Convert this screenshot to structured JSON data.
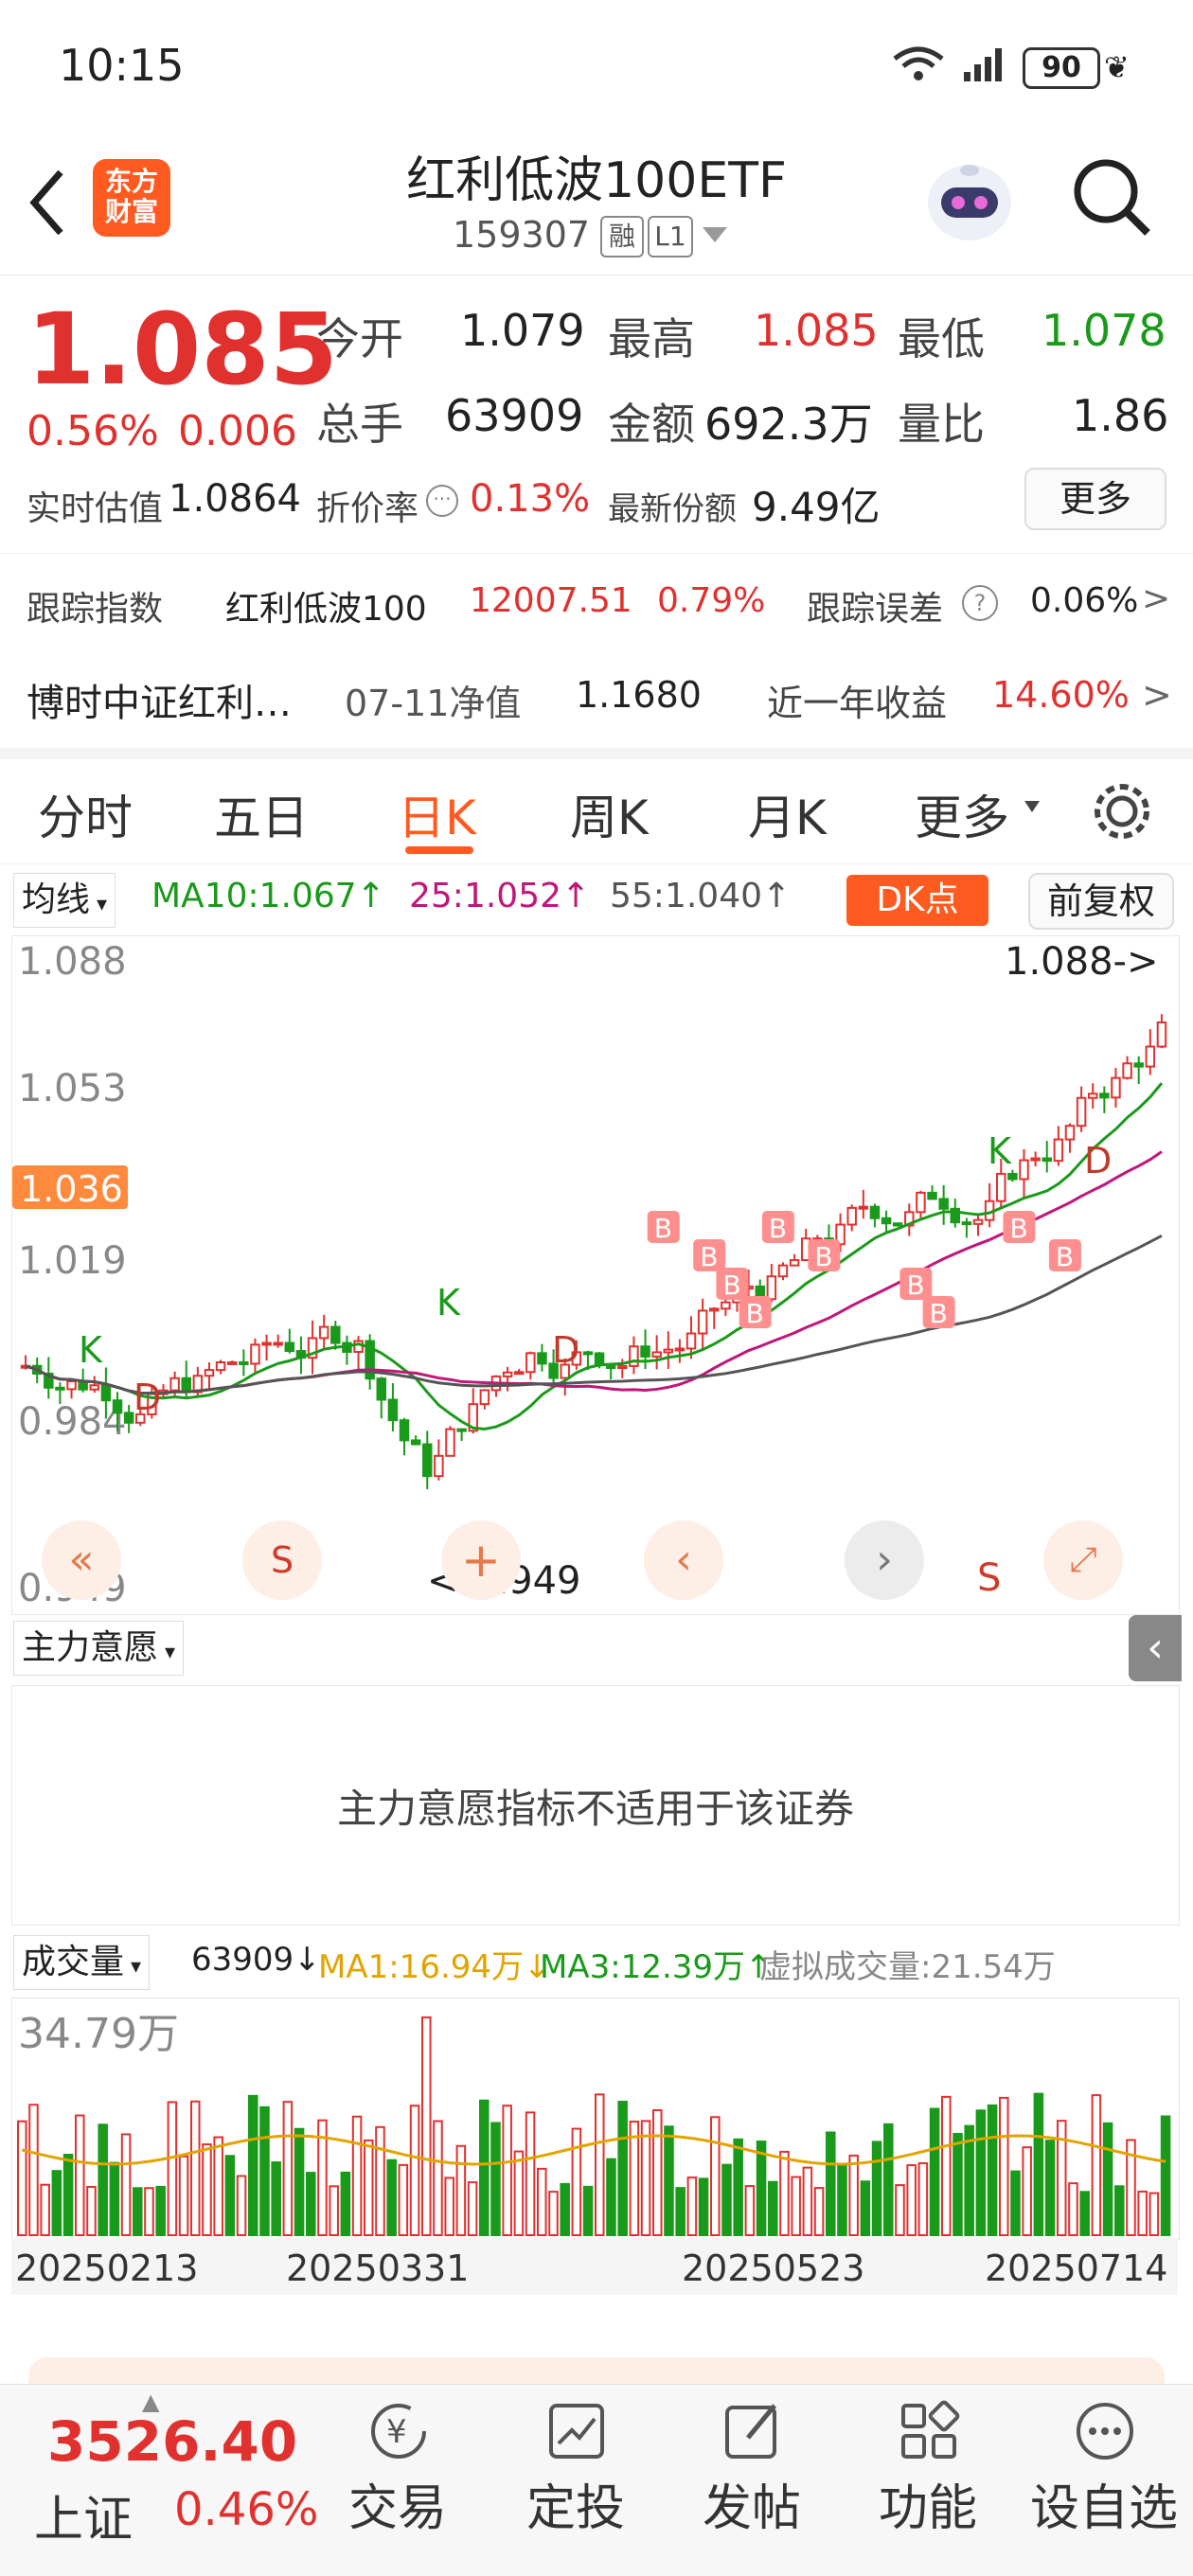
{
  "status_bar": {
    "time": "10:15",
    "battery": "90"
  },
  "header": {
    "logo_line1": "东方",
    "logo_line2": "财富",
    "title": "红利低波100ETF",
    "code": "159307",
    "badge_rong": "融",
    "badge_level": "L1"
  },
  "quote": {
    "price": "1.085",
    "change_pct": "0.56%",
    "change": "0.006",
    "open_label": "今开",
    "open": "1.079",
    "high_label": "最高",
    "high": "1.085",
    "low_label": "最低",
    "low": "1.078",
    "volume_label": "总手",
    "volume": "63909",
    "amount_label": "金额",
    "amount": "692.3万",
    "ratio_label": "量比",
    "ratio": "1.86",
    "iopv_label": "实时估值",
    "iopv": "1.0864",
    "premium_label": "折价率",
    "premium": "0.13%",
    "shares_label": "最新份额",
    "shares": "9.49亿",
    "more_button": "更多"
  },
  "tracking": {
    "label": "跟踪指数",
    "index_name": "红利低波100",
    "index_value": "12007.51",
    "index_pct": "0.79%",
    "error_label": "跟踪误差",
    "error_value": "0.06%"
  },
  "fund": {
    "name": "博时中证红利…",
    "nav_label": "07-11净值",
    "nav": "1.1680",
    "return_label": "近一年收益",
    "return": "14.60%"
  },
  "tabs": [
    "分时",
    "五日",
    "日K",
    "周K",
    "月K",
    "更多"
  ],
  "active_tab": "日K",
  "ma_bar": {
    "selector": "均线",
    "ma10": "MA10:1.067↑",
    "ma25": "25:1.052↑",
    "ma55": "55:1.040↑",
    "dk_button": "DK点",
    "adjust_button": "前复权"
  },
  "kchart": {
    "y_labels": [
      "1.088",
      "1.053",
      "1.019",
      "0.984",
      "0.949"
    ],
    "current_tag": "1.036",
    "high_note": "1.088->",
    "low_note": "<-0.949",
    "signal_labels": [
      "K",
      "D",
      "K",
      "D",
      "K",
      "D"
    ],
    "buy_label": "B",
    "sell_label": "S",
    "colors": {
      "up": "#e0312f",
      "down": "#1a9a1a",
      "ma10": "#1a9a1a",
      "ma25": "#c0177a",
      "ma55": "#555555"
    }
  },
  "indicator": {
    "selector": "主力意愿",
    "message": "主力意愿指标不适用于该证券"
  },
  "volume_panel": {
    "selector": "成交量",
    "vol": "63909↓",
    "ma1": "MA1:16.94万↓",
    "ma3": "MA3:12.39万↑",
    "virtual": "虚拟成交量:21.54万",
    "max_label": "34.79万",
    "dates": [
      "20250213",
      "20250331",
      "20250523",
      "20250714"
    ]
  },
  "bottom_bar": {
    "index_value": "3526.40",
    "index_name": "上证",
    "index_pct": "0.46%",
    "items": [
      "交易",
      "定投",
      "发帖",
      "功能",
      "设自选"
    ]
  }
}
